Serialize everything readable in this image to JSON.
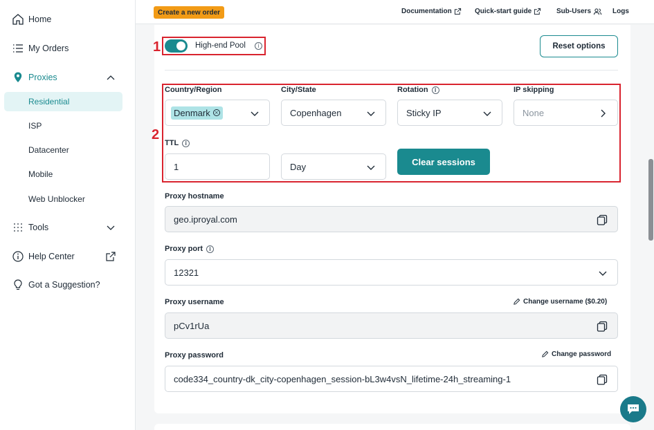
{
  "sidebar": {
    "home": "Home",
    "orders": "My Orders",
    "proxies": "Proxies",
    "proxy_types": [
      "Residential",
      "ISP",
      "Datacenter",
      "Mobile",
      "Web Unblocker"
    ],
    "tools": "Tools",
    "help": "Help Center",
    "suggestion": "Got a Suggestion?"
  },
  "topbar": {
    "new_order": "Create a new order",
    "documentation": "Documentation",
    "quick_start": "Quick-start guide",
    "sub_users": "Sub-Users",
    "logs": "Logs"
  },
  "pool": {
    "label": "High-end Pool",
    "enabled": true,
    "reset_label": "Reset options"
  },
  "config": {
    "country_label": "Country/Region",
    "country_value": "Denmark",
    "city_label": "City/State",
    "city_value": "Copenhagen",
    "rotation_label": "Rotation",
    "rotation_value": "Sticky IP",
    "ip_skipping_label": "IP skipping",
    "ip_skipping_value": "None",
    "ttl_label": "TTL",
    "ttl_value": "1",
    "ttl_unit": "Day",
    "clear_sessions": "Clear sessions"
  },
  "proxy": {
    "hostname_label": "Proxy hostname",
    "hostname_value": "geo.iproyal.com",
    "port_label": "Proxy port",
    "port_value": "12321",
    "username_label": "Proxy username",
    "change_username": "Change username ($0.20)",
    "username_value": "pCv1rUa",
    "password_label": "Proxy password",
    "change_password": "Change password",
    "password_value": "code334_country-dk_city-copenhagen_session-bL3w4vsN_lifetime-24h_streaming-1"
  },
  "annotations": [
    "1",
    "2"
  ],
  "colors": {
    "accent": "#1a8a8f",
    "order_button": "#f29b16",
    "annotation": "#d9232e"
  }
}
